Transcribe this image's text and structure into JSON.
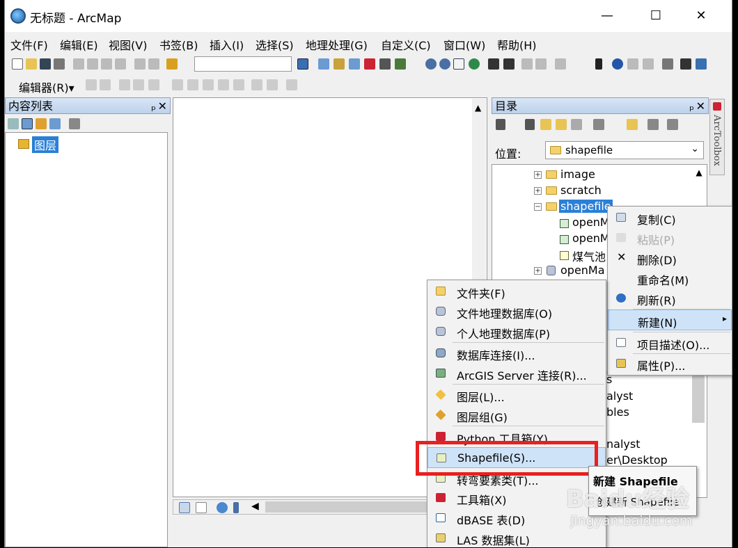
{
  "window": {
    "title": "无标题 - ArcMap",
    "minimize": "—",
    "maximize": "☐",
    "close": "✕"
  },
  "menubar": [
    "文件(F)",
    "编辑(E)",
    "视图(V)",
    "书签(B)",
    "插入(I)",
    "选择(S)",
    "地理处理(G)",
    "自定义(C)",
    "窗口(W)",
    "帮助(H)"
  ],
  "editor_toolbar": {
    "label": "编辑器(R)▾"
  },
  "toc": {
    "title": "内容列表",
    "layer": "图层",
    "pin": "ₚ",
    "close": "✕"
  },
  "catalog": {
    "title": "目录",
    "location_label": "位置:",
    "location_value": "shapefile",
    "pin": "ₚ",
    "close": "✕",
    "tree": [
      {
        "label": "image"
      },
      {
        "label": "scratch"
      },
      {
        "label": "shapefile"
      },
      {
        "label": "openM"
      },
      {
        "label": "openM"
      },
      {
        "label": "煤气池"
      },
      {
        "label": "openMa"
      }
    ],
    "partial": [
      "s",
      "alyst",
      "bles",
      "nalyst",
      "er\\Desktop"
    ]
  },
  "arctoolbox": {
    "label": "ArcToolbox"
  },
  "context_menu": {
    "items": [
      {
        "label": "复制(C)",
        "icon": "copy-icon"
      },
      {
        "label": "粘贴(P)",
        "icon": "paste-icon"
      },
      {
        "label": "删除(D)",
        "icon": "delete-icon"
      },
      {
        "label": "重命名(M)",
        "icon": ""
      },
      {
        "label": "刷新(R)",
        "icon": "refresh-icon"
      },
      {
        "label": "新建(N)",
        "icon": ""
      },
      {
        "label": "项目描述(O)...",
        "icon": "description-icon"
      },
      {
        "label": "属性(P)...",
        "icon": "properties-icon"
      }
    ],
    "submenu_arrow": "▸"
  },
  "new_submenu": {
    "items": [
      {
        "label": "文件夹(F)",
        "icon": "folder-icon"
      },
      {
        "label": "文件地理数据库(O)",
        "icon": "gdb-icon"
      },
      {
        "label": "个人地理数据库(P)",
        "icon": "pgdb-icon"
      },
      {
        "label": "数据库连接(I)...",
        "icon": "dbconn-icon"
      },
      {
        "label": "ArcGIS Server 连接(R)...",
        "icon": "server-icon"
      },
      {
        "label": "图层(L)...",
        "icon": "layer-icon"
      },
      {
        "label": "图层组(G)",
        "icon": "layergroup-icon"
      },
      {
        "label": "Python 工具箱(Y)",
        "icon": "pytoolbox-icon"
      },
      {
        "label": "Shapefile(S)...",
        "icon": "shapefile-icon"
      },
      {
        "label": "转弯要素类(T)...",
        "icon": "turn-icon"
      },
      {
        "label": "工具箱(X)",
        "icon": "toolbox-icon"
      },
      {
        "label": "dBASE 表(D)",
        "icon": "dbase-icon"
      },
      {
        "label": "LAS 数据集(L)",
        "icon": "las-icon"
      }
    ]
  },
  "tooltip": {
    "title": "新建 Shapefile",
    "body": "创建新 Shapefile"
  },
  "watermark": {
    "line1": "Baidu经验",
    "line2": "jingyan.baidu.com"
  },
  "colors": {
    "highlight": "#cfe3f8",
    "red_box": "#e8201f",
    "panel_header": "#c4d7ee"
  }
}
